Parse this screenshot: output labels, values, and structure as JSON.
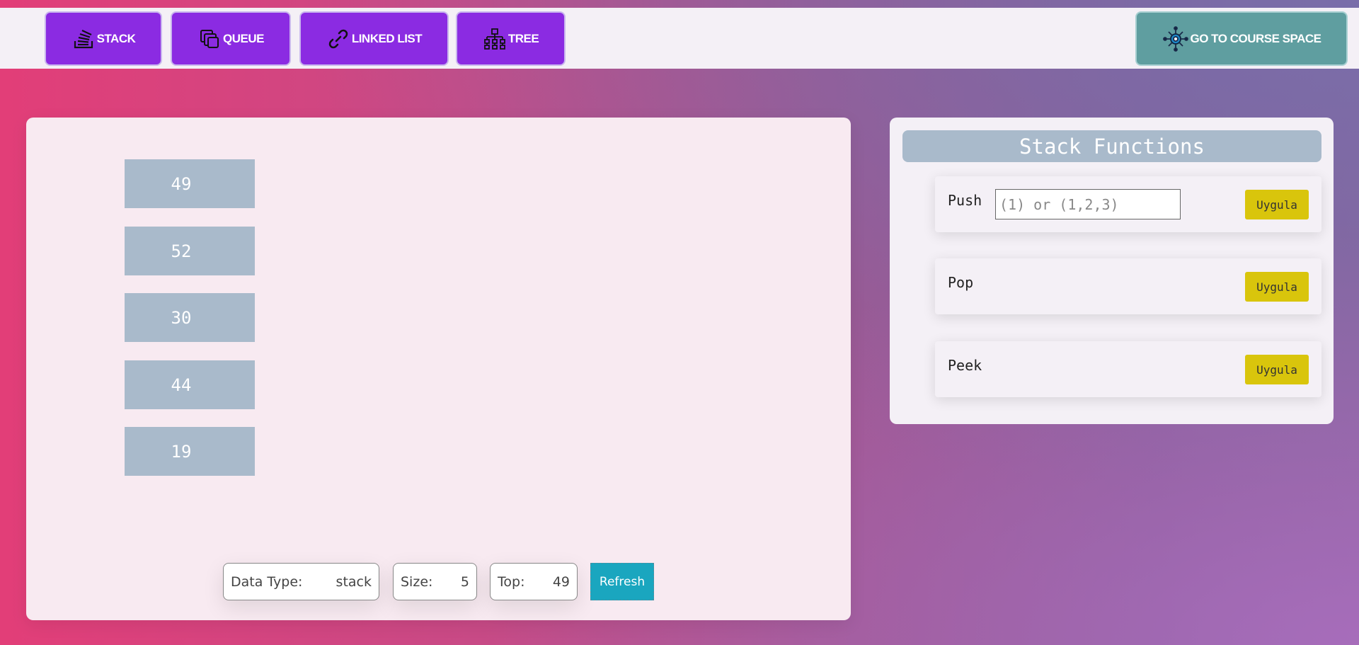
{
  "nav": {
    "stack": {
      "label": "STACK",
      "icon": "stack-icon"
    },
    "queue": {
      "label": "QUEUE",
      "icon": "queue-icon"
    },
    "linked_list": {
      "label": "LINKED LIST",
      "icon": "link-icon"
    },
    "tree": {
      "label": "TREE",
      "icon": "tree-icon"
    },
    "course": {
      "label": "GO TO COURSE SPACE",
      "icon": "course-icon"
    }
  },
  "stack": {
    "items": [
      "49",
      "52",
      "30",
      "44",
      "19"
    ]
  },
  "info": {
    "data_type_label": "Data Type:",
    "data_type_value": "stack",
    "size_label": "Size:",
    "size_value": "5",
    "top_label": "Top:",
    "top_value": "49",
    "refresh_label": "Refresh"
  },
  "functions": {
    "title": "Stack Functions",
    "push": {
      "label": "Push",
      "placeholder": "(1) or (1,2,3)",
      "button": "Uygula"
    },
    "pop": {
      "label": "Pop",
      "button": "Uygula"
    },
    "peek": {
      "label": "Peek",
      "button": "Uygula"
    }
  },
  "colors": {
    "nav_button": "#8b2be2",
    "course_button": "#5f9ea0",
    "stack_item": "#a9bacb",
    "apply_button": "#d9c50c",
    "refresh_button": "#1aa6bf"
  }
}
